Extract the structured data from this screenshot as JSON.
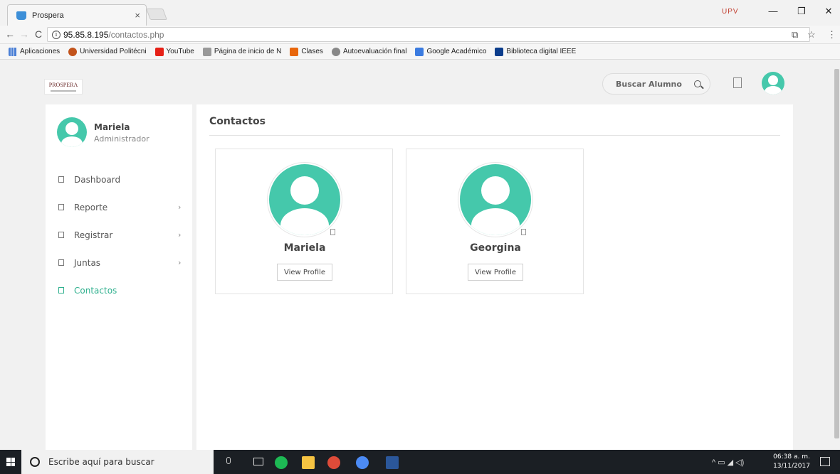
{
  "browser": {
    "tab_title": "Prospera",
    "tab_close": "×",
    "profile_badge": "UPV",
    "url_host": "95.85.8.195",
    "url_path": "/contactos.php",
    "window_controls": {
      "minimize": "—",
      "maximize": "❐",
      "close": "✕"
    },
    "nav": {
      "back": "←",
      "forward": "→",
      "reload": "C"
    },
    "bookmarks": [
      {
        "label": "Aplicaciones",
        "icon": "apps-grid-icon"
      },
      {
        "label": "Universidad Politécni",
        "icon": "upv-icon"
      },
      {
        "label": "YouTube",
        "icon": "youtube-icon"
      },
      {
        "label": "Página de inicio de N",
        "icon": "unam-icon"
      },
      {
        "label": "Clases",
        "icon": "clases-icon"
      },
      {
        "label": "Autoevaluación final",
        "icon": "autoevaluacion-icon"
      },
      {
        "label": "Google Académico",
        "icon": "scholar-icon"
      },
      {
        "label": "Biblioteca digital IEEE",
        "icon": "ieee-icon"
      }
    ]
  },
  "app": {
    "brand": "PROSPERA",
    "search_placeholder": "Buscar Alumno",
    "accent_color": "#45c8ab",
    "active_color": "#2fb08e"
  },
  "sidebar": {
    "user_name": "Mariela",
    "user_role": "Administrador",
    "items": [
      {
        "label": "Dashboard",
        "has_submenu": false,
        "active": false
      },
      {
        "label": "Reporte",
        "has_submenu": true,
        "active": false
      },
      {
        "label": "Registrar",
        "has_submenu": true,
        "active": false
      },
      {
        "label": "Juntas",
        "has_submenu": true,
        "active": false
      },
      {
        "label": "Contactos",
        "has_submenu": false,
        "active": true
      }
    ],
    "chevron": "›"
  },
  "main": {
    "title": "Contactos",
    "contacts": [
      {
        "name": "Mariela",
        "button_label": "View Profile"
      },
      {
        "name": "Georgina",
        "button_label": "View Profile"
      }
    ]
  },
  "taskbar": {
    "search_text": "Escribe aquí para buscar",
    "time": "06:38 a. m.",
    "date": "13/11/2017",
    "tray": "^ ▭ ◢ ◁)"
  }
}
